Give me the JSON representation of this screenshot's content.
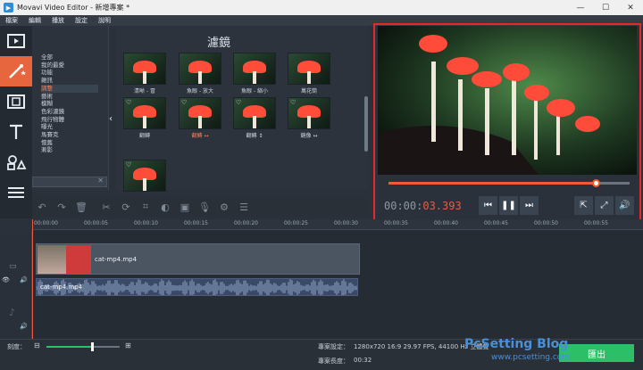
{
  "window": {
    "title": "Movavi Video Editor - 新增專案 *",
    "minimize": "—",
    "maximize": "☐",
    "close": "✕"
  },
  "menu": {
    "items": [
      "檔案",
      "編輯",
      "播放",
      "設定",
      "說明"
    ]
  },
  "sidebar_tools": [
    {
      "name": "import-media-icon"
    },
    {
      "name": "filters-icon"
    },
    {
      "name": "transitions-icon"
    },
    {
      "name": "titles-icon"
    },
    {
      "name": "stickers-icon"
    },
    {
      "name": "more-tools-icon"
    }
  ],
  "filters": {
    "title": "濾鏡",
    "categories": [
      "全部",
      "我的最愛",
      "功能",
      "雜訊",
      "調整",
      "藝術",
      "模糊",
      "色彩濾鏡",
      "飛行物體",
      "曝光",
      "馬賽克",
      "懷舊",
      "漸影"
    ],
    "selected_category": "調整",
    "thumbs": [
      {
        "label": "清晰 - 冒",
        "selected": false,
        "fav": false
      },
      {
        "label": "魚眼 - 放大",
        "selected": false,
        "fav": false
      },
      {
        "label": "魚眼 - 縮小",
        "selected": false,
        "fav": false
      },
      {
        "label": "萬花筒",
        "selected": false,
        "fav": false
      },
      {
        "label": "翻轉",
        "selected": false,
        "fav": true
      },
      {
        "label": "翻轉 ↔",
        "selected": true,
        "fav": true
      },
      {
        "label": "翻轉 ↕",
        "selected": false,
        "fav": true
      },
      {
        "label": "鏡像 ↔",
        "selected": false,
        "fav": true
      },
      {
        "label": "",
        "selected": false,
        "fav": true
      }
    ],
    "search_clear": "✕"
  },
  "player": {
    "time_gray": "00:00:",
    "time_red": "03.393",
    "progress_fraction": 0.86,
    "prev_icon": "⏮",
    "pause_icon": "❚❚",
    "next_icon": "⏭",
    "export_icon": "⇱",
    "fullscreen_icon": "⤢",
    "volume_icon": "🔊"
  },
  "ruler_ticks": [
    "00:00:00",
    "00:00:05",
    "00:00:10",
    "00:00:15",
    "00:00:20",
    "00:00:25",
    "00:00:30",
    "00:00:35",
    "00:00:40",
    "00:00:45",
    "00:00:50",
    "00:00:55"
  ],
  "timeline": {
    "video_clip_label": "cat-mp4.mp4",
    "audio_clip_label": "cat-mp4.mp4"
  },
  "status": {
    "zoom_label": "刻度：",
    "zoom_fraction": 0.62,
    "project_settings_label": "專案設定：",
    "project_settings_value": "1280x720 16:9 29.97 FPS, 44100 Hz 立體聲",
    "project_length_label": "專案長度：",
    "project_length_value": "00:32",
    "export_label": "匯出"
  },
  "watermark": {
    "line1": "PcSetting Blog",
    "line2": "www.pcsetting.com"
  },
  "colors": {
    "accent": "#ef5a3f",
    "export_green": "#2cbf67",
    "highlight_border": "#e12b2b"
  }
}
